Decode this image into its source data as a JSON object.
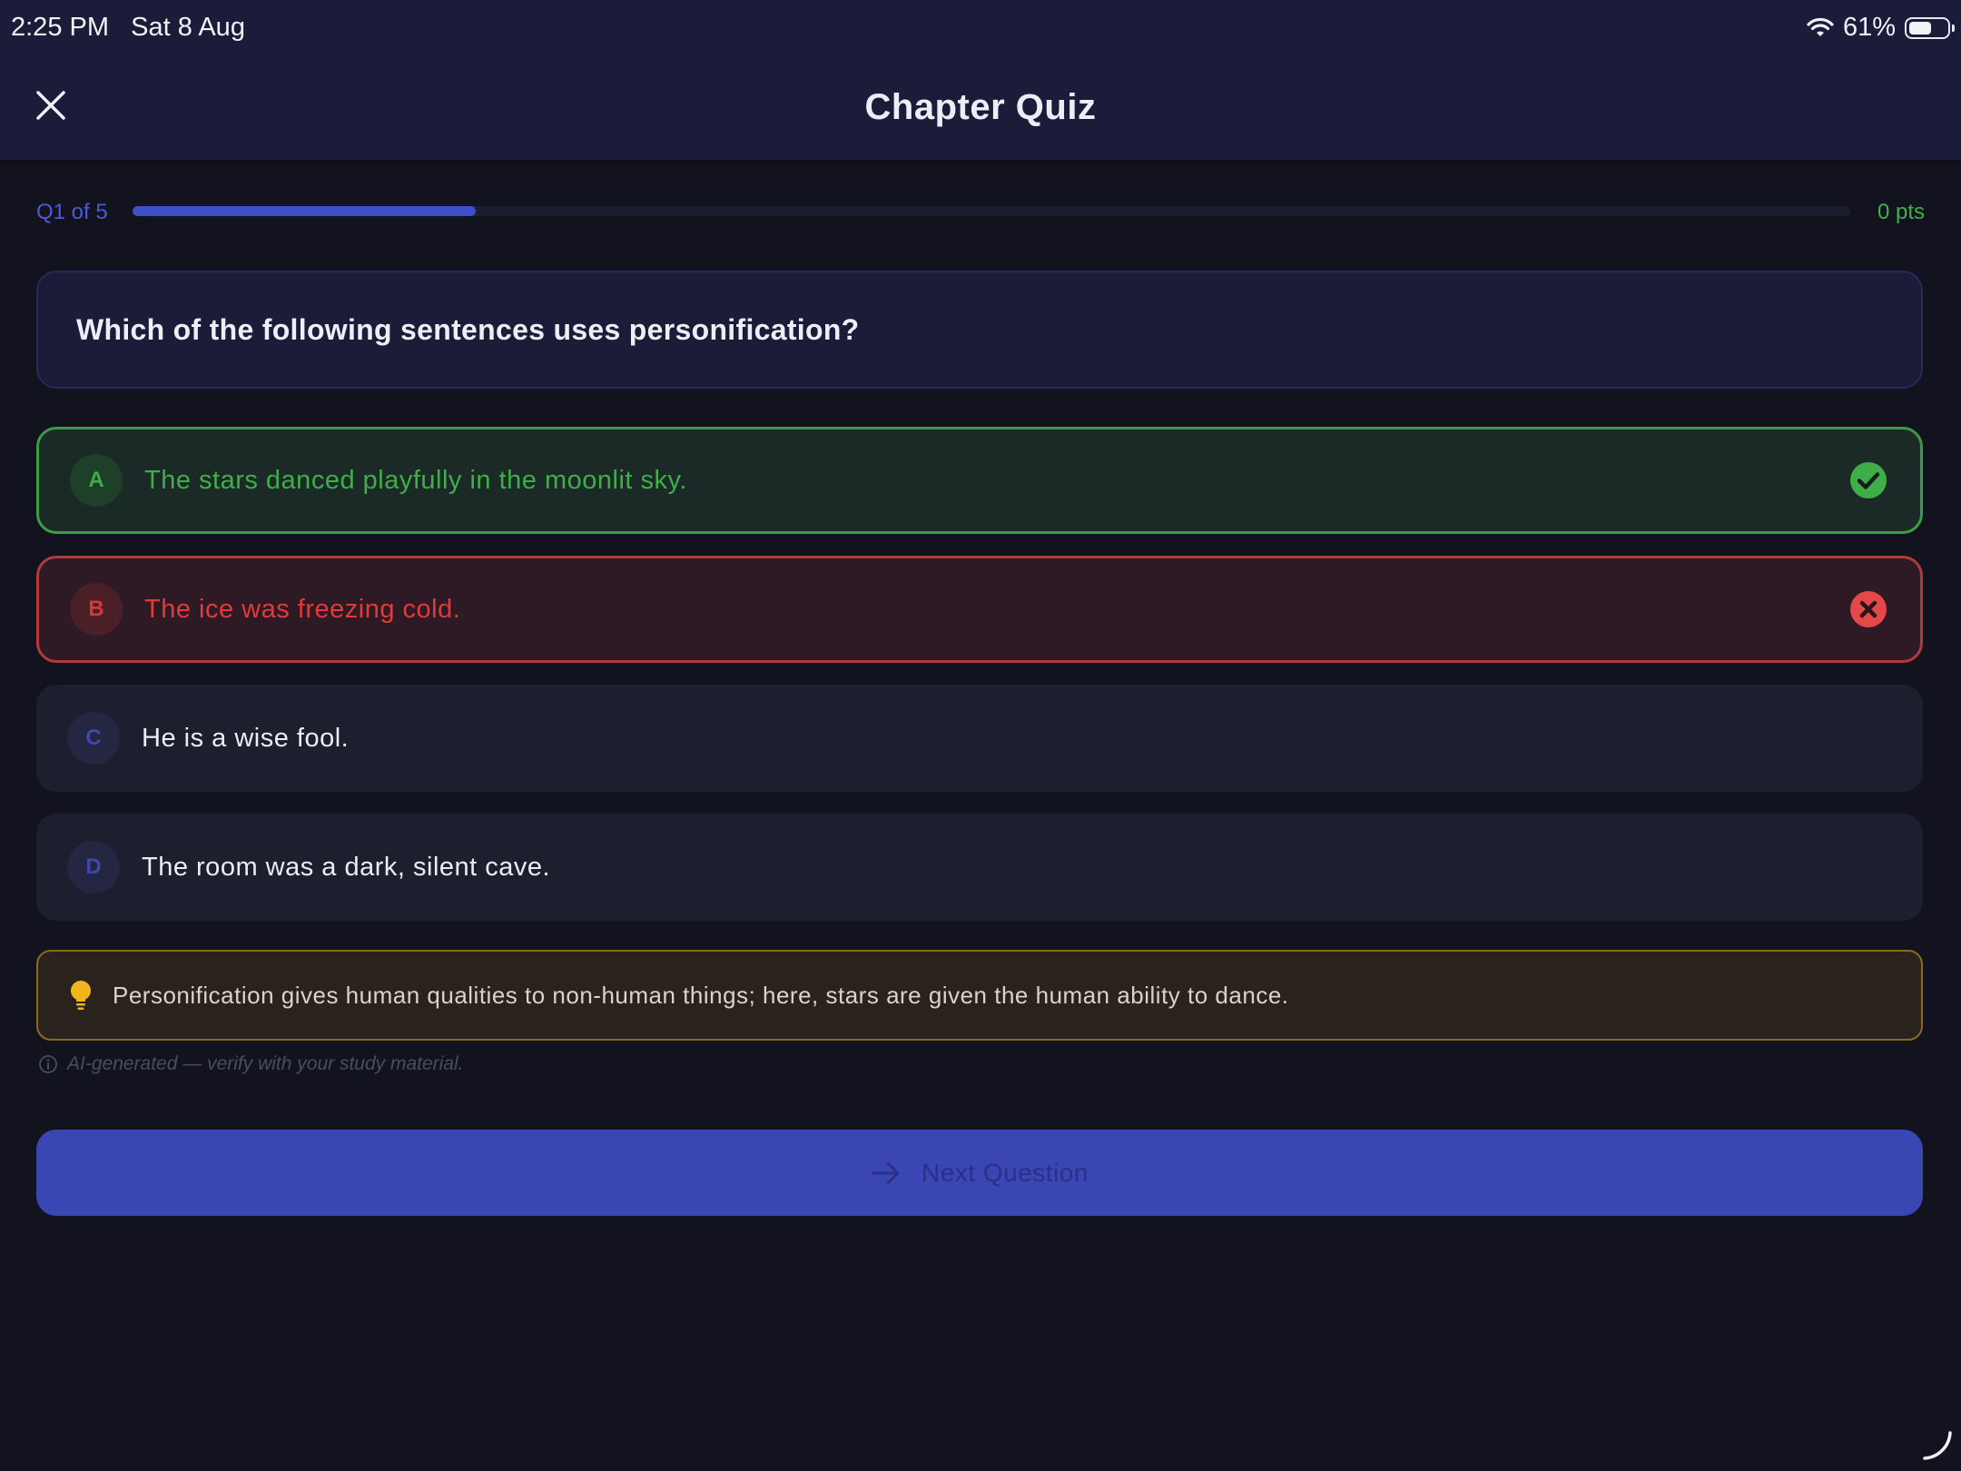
{
  "status_bar": {
    "time": "2:25 PM",
    "date": "Sat 8 Aug",
    "battery": "61%",
    "battery_level": 0.61
  },
  "header": {
    "title": "Chapter Quiz",
    "close_icon": "close-icon"
  },
  "progress": {
    "label": "Q1 of 5",
    "fraction": 0.2,
    "points": "0 pts"
  },
  "question": {
    "text": "Which of the following sentences uses personification?"
  },
  "options": [
    {
      "letter": "A",
      "text": "The stars danced playfully in the moonlit sky.",
      "state": "correct",
      "icon": "check-circle-icon"
    },
    {
      "letter": "B",
      "text": "The ice was freezing cold.",
      "state": "incorrect",
      "icon": "x-circle-icon"
    },
    {
      "letter": "C",
      "text": "He is a wise fool.",
      "state": "neutral"
    },
    {
      "letter": "D",
      "text": "The room was a dark, silent cave.",
      "state": "neutral"
    }
  ],
  "hint": {
    "icon": "lightbulb-icon",
    "text": "Personification gives human qualities to non-human things; here, stars are given the human ability to dance."
  },
  "disclaimer": {
    "icon": "info-icon",
    "text": "AI-generated — verify with your study material."
  },
  "next_button": {
    "icon": "arrow-right-icon",
    "label": "Next Question"
  },
  "colors": {
    "accent": "#3f4fc8",
    "correct": "#3fae48",
    "incorrect": "#e03a3a",
    "hint_border": "#8c6a1e",
    "background": "#13131f"
  }
}
